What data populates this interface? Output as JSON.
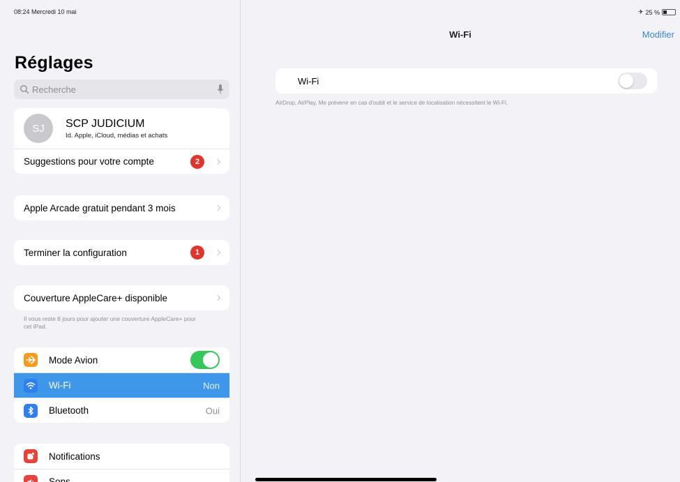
{
  "status": {
    "time_date": "08:24  Mercredi 10 mai",
    "battery": "25 %"
  },
  "sidebar": {
    "title": "Réglages",
    "search_placeholder": "Recherche",
    "profile": {
      "initials": "SJ",
      "name": "SCP JUDICIUM",
      "subtitle": "Id. Apple, iCloud, médias et achats"
    },
    "suggestions": {
      "label": "Suggestions pour votre compte",
      "badge": "2"
    },
    "arcade": {
      "label": "Apple Arcade gratuit pendant 3 mois"
    },
    "setup": {
      "label": "Terminer la configuration",
      "badge": "1"
    },
    "applecare": {
      "label": "Couverture AppleCare+ disponible",
      "footnote": "Il vous reste 8 jours pour ajouter une couverture AppleCare+ pour cet iPad."
    },
    "settings": [
      {
        "label": "Mode Avion",
        "value": "",
        "icon": "airplane-icon",
        "color": "#f39c1e"
      },
      {
        "label": "Wi-Fi",
        "value": "Non",
        "icon": "wifi-icon",
        "color": "#2f7fef"
      },
      {
        "label": "Bluetooth",
        "value": "Oui",
        "icon": "bluetooth-icon",
        "color": "#2f7fef"
      }
    ],
    "notifications": [
      {
        "label": "Notifications",
        "icon": "notifications-icon",
        "color": "#e8433b"
      },
      {
        "label": "Sons",
        "icon": "sounds-icon",
        "color": "#e8433b"
      }
    ]
  },
  "detail": {
    "title": "Wi-Fi",
    "edit": "Modifier",
    "wifi_label": "Wi-Fi",
    "note": "AirDrop, AirPlay, Me prévenir en cas d'oubli et le service de localisation nécessitent le Wi-Fi."
  },
  "colors": {
    "accent": "#3a88d8",
    "selected": "#3e97e8",
    "toggle_on": "#34c759",
    "badge": "#e0342c"
  }
}
